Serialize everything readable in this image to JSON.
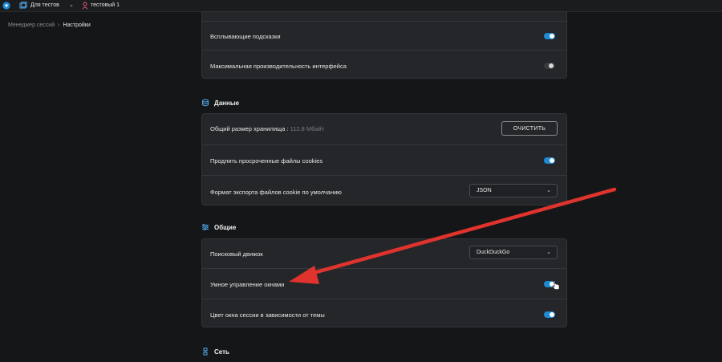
{
  "topbar": {
    "folder_label": "Для тестов",
    "chevron": "⌄",
    "user_label": "тестовый 1",
    "icons": [
      "app-logo-icon",
      "folder-icon",
      "chevron-down-icon",
      "user-icon"
    ]
  },
  "breadcrumb": {
    "parent": "Менеджер сессий",
    "separator": "›",
    "current": "Настройки"
  },
  "interface_card": {
    "rows": [
      {
        "label": "Всплывающие подсказки",
        "toggle": "on"
      },
      {
        "label": "Максимальная производительность интерфейса",
        "toggle": "off"
      }
    ]
  },
  "data_section": {
    "title": "Данные",
    "storage_label": "Общий размер хранилища :",
    "storage_value": "112.8 Мбайт",
    "clear_button": "ОЧИСТИТЬ",
    "extend_cookies_label": "Продлить просроченные файлы cookies",
    "extend_cookies_toggle": "on",
    "cookie_format_label": "Формат экспорта файлов cookie по умолчанию",
    "cookie_format_value": "JSON"
  },
  "general_section": {
    "title": "Общие",
    "search_engine_label": "Поисковый движок",
    "search_engine_value": "DuckDuckGo",
    "smart_windows_label": "Умное управление окнами",
    "smart_windows_toggle": "on",
    "theme_color_label": "Цвет окна сессии в зависимости от темы",
    "theme_color_toggle": "on"
  },
  "network_section": {
    "title": "Сеть"
  },
  "colors": {
    "accent": "#1f8ad4",
    "annotation_arrow": "#e0332d",
    "background": "#151618",
    "card": "#252629"
  }
}
